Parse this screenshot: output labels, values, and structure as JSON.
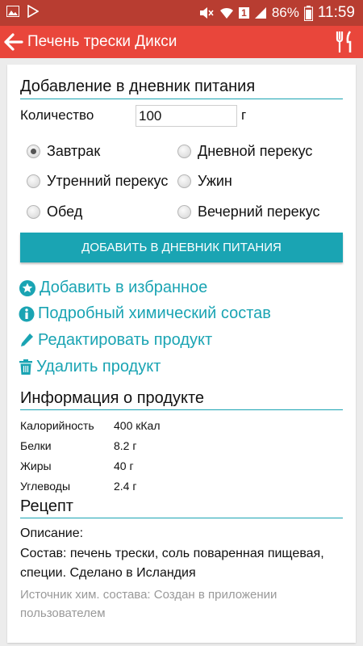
{
  "status_bar": {
    "battery": "86%",
    "time": "11:59",
    "sim": "1"
  },
  "app_bar": {
    "title": "Печень трески Дикси"
  },
  "diary": {
    "title": "Добавление в дневник питания",
    "quantity_label": "Количество",
    "quantity_value": "100",
    "unit": "г",
    "meals": [
      {
        "label": "Завтрак",
        "checked": true
      },
      {
        "label": "Дневной перекус",
        "checked": false
      },
      {
        "label": "Утренний перекус",
        "checked": false
      },
      {
        "label": "Ужин",
        "checked": false
      },
      {
        "label": "Обед",
        "checked": false
      },
      {
        "label": "Вечерний перекус",
        "checked": false
      }
    ],
    "add_button": "ДОБАВИТЬ В ДНЕВНИК ПИТАНИЯ"
  },
  "actions": [
    {
      "label": "Добавить в избранное",
      "icon": "star-icon"
    },
    {
      "label": "Подробный химический состав",
      "icon": "info-icon"
    },
    {
      "label": "Редактировать продукт",
      "icon": "pencil-icon"
    },
    {
      "label": "Удалить продукт",
      "icon": "trash-icon"
    }
  ],
  "info": {
    "title": "Информация о продукте",
    "rows": [
      {
        "label": "Калорийность",
        "value": "400 кКал"
      },
      {
        "label": "Белки",
        "value": "8.2 г"
      },
      {
        "label": "Жиры",
        "value": "40 г"
      },
      {
        "label": "Углеводы",
        "value": "2.4 г"
      }
    ]
  },
  "recipe": {
    "title": "Рецепт",
    "description_label": "Описание:",
    "composition": "Состав: печень трески, соль поваренная пищевая, специи. Сделано в Исландия",
    "source": "Источник хим. состава: Создан в приложении пользователем"
  },
  "colors": {
    "accent": "#1aa4b3",
    "app_bar": "#e9463b",
    "status_bar": "#b83d31"
  }
}
